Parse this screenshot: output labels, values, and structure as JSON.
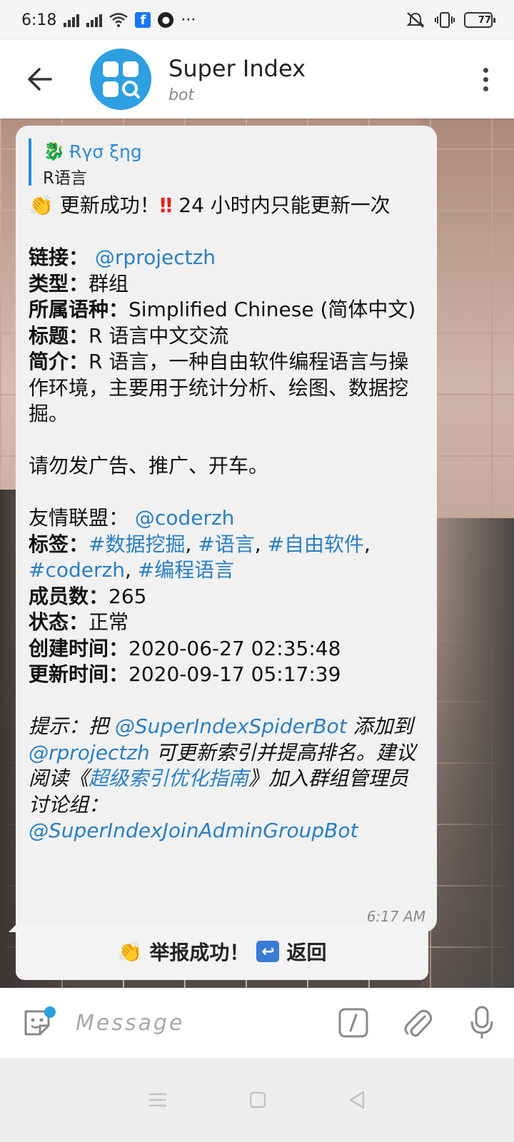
{
  "status_bar": {
    "time": "6:18",
    "more": "···",
    "battery": "77",
    "battery_level": 0.77
  },
  "header": {
    "title": "Super Index",
    "subtitle": "bot"
  },
  "message": {
    "reply": {
      "name": "Ɍγσ ξηg",
      "text": "R语言"
    },
    "line_success": "更新成功！",
    "line_success_rest": "24 小时内只能更新一次",
    "link_label": "链接：",
    "link_value": "@rprojectzh",
    "type_label": "类型：",
    "type_value": "群组",
    "lang_label": "所属语种：",
    "lang_value": "Simplified Chinese (简体中文)",
    "title_label": "标题：",
    "title_value": "R 语言中文交流",
    "intro_label": "简介：",
    "intro_value": "R 语言，一种自由软件编程语言与操作环境，主要用于统计分析、绘图、数据挖掘。",
    "notice": "请勿发广告、推广、开车。",
    "friends_label": "友情联盟：",
    "friends_value": "@coderzh",
    "tags_label": "标签：",
    "tags": [
      "#数据挖掘",
      "#语言",
      "#自由软件",
      "#coderzh",
      "#编程语言"
    ],
    "members_label": "成员数：",
    "members_value": "265",
    "state_label": "状态：",
    "state_value": "正常",
    "created_label": "创建时间：",
    "created_value": "2020-06-27 02:35:48",
    "updated_label": "更新时间：",
    "updated_value": "2020-09-17 05:17:39",
    "tip_1": "提示：把 ",
    "tip_bot": "@SuperIndexSpiderBot",
    "tip_2": " 添加到 ",
    "tip_group": "@rprojectzh",
    "tip_3": " 可更新索引并提高排名。建议阅读《",
    "tip_guide": "超级索引优化指南",
    "tip_4": "》加入群组管理员讨论组：",
    "tip_admin": "@SuperIndexJoinAdminGroupBot",
    "time": "6:17 AM"
  },
  "inline_button": {
    "report": "举报成功！",
    "back": "返回"
  },
  "input": {
    "placeholder": "Message"
  },
  "colors": {
    "accent": "#2e9fe0",
    "link": "#2a7fc3",
    "bubble": "#f1f1f1"
  }
}
